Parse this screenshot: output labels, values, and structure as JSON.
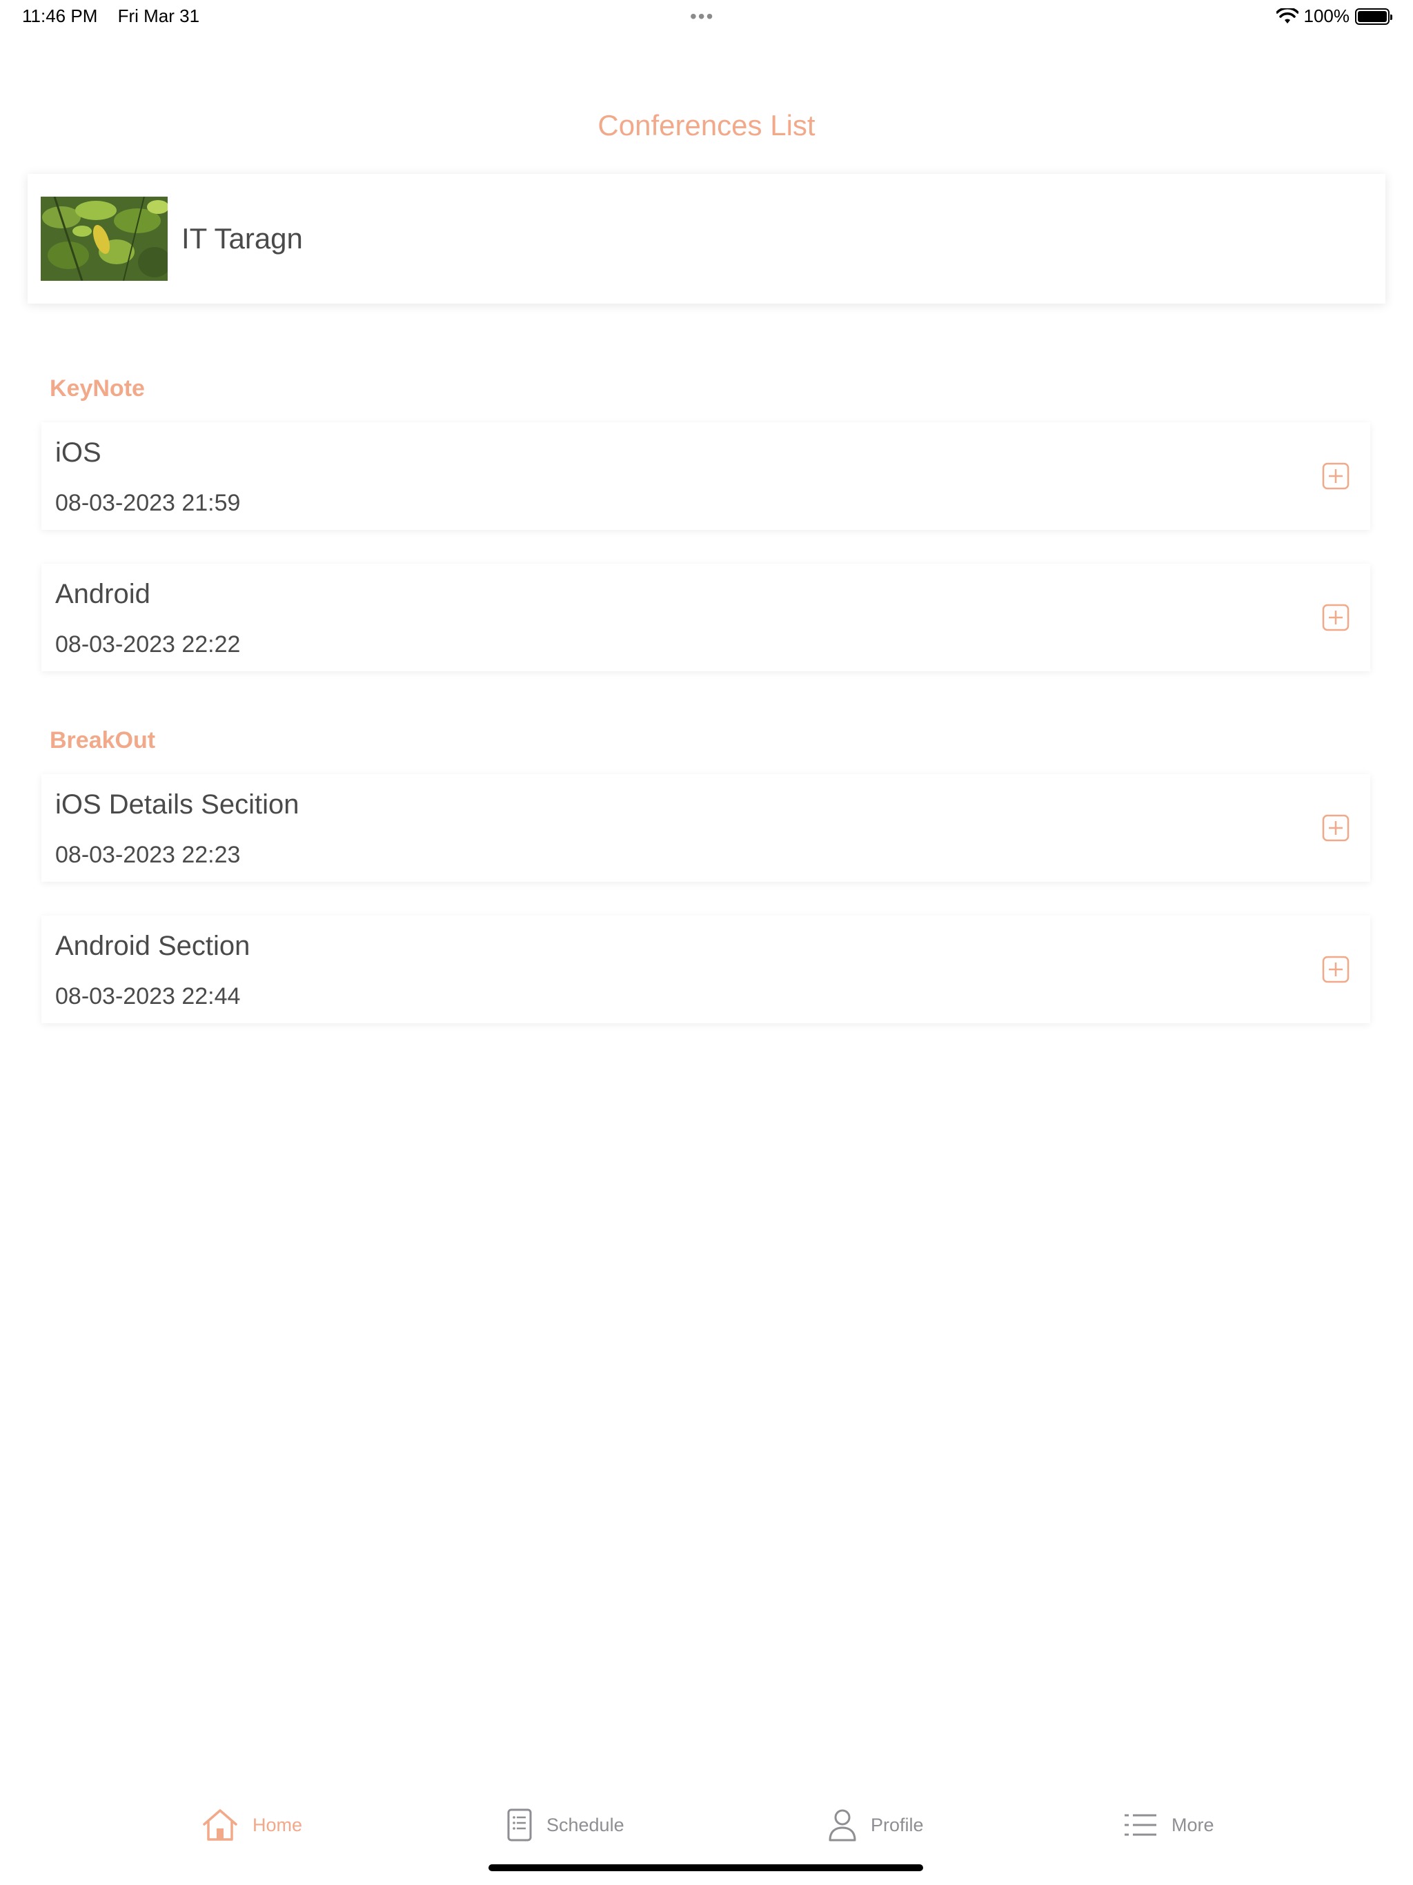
{
  "status_bar": {
    "time": "11:46 PM",
    "date": "Fri Mar 31",
    "dots": "•••",
    "battery": "100%"
  },
  "page": {
    "title": "Conferences List"
  },
  "conference": {
    "name": "IT Taragn"
  },
  "sections": [
    {
      "header": "KeyNote",
      "sessions": [
        {
          "title": "iOS",
          "date": "08-03-2023 21:59"
        },
        {
          "title": "Android",
          "date": "08-03-2023 22:22"
        }
      ]
    },
    {
      "header": "BreakOut",
      "sessions": [
        {
          "title": "iOS Details Secition",
          "date": "08-03-2023 22:23"
        },
        {
          "title": "Android Section",
          "date": "08-03-2023 22:44"
        }
      ]
    }
  ],
  "tabs": [
    {
      "label": "Home",
      "icon": "home-icon",
      "active": true
    },
    {
      "label": "Schedule",
      "icon": "schedule-icon",
      "active": false
    },
    {
      "label": "Profile",
      "icon": "profile-icon",
      "active": false
    },
    {
      "label": "More",
      "icon": "list-icon",
      "active": false
    }
  ],
  "colors": {
    "accent": "#f2a98a",
    "text": "#4a4a4a",
    "inactive": "#8e8e93"
  }
}
